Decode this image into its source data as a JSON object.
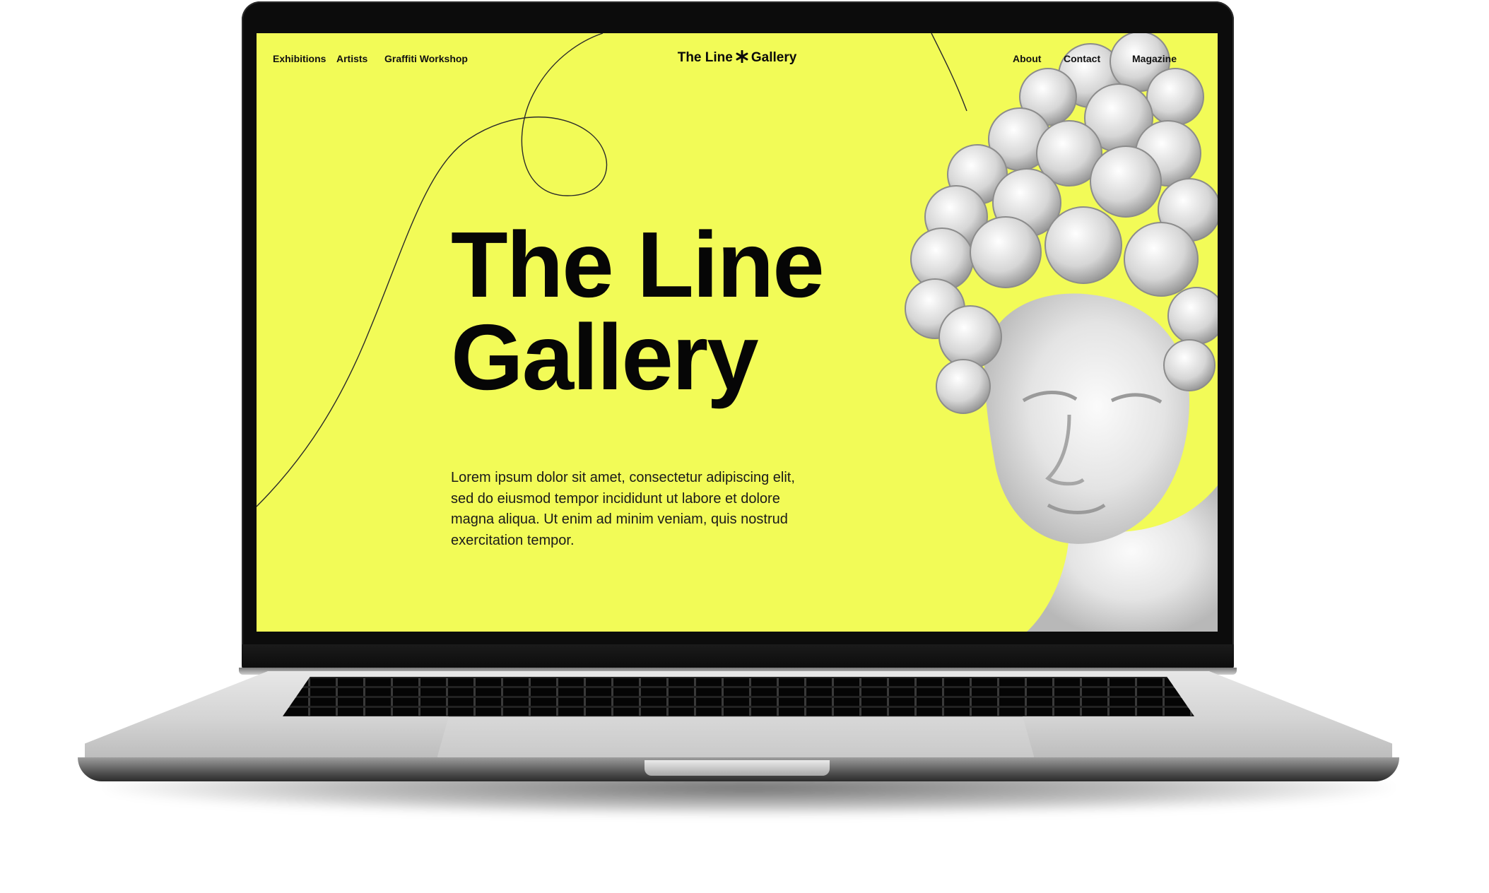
{
  "page": {
    "brand": {
      "left": "The Line",
      "right": "Gallery",
      "icon": "asterisk-icon"
    },
    "nav_left": [
      "Exhibitions",
      "Artists",
      "Graffiti Workshop"
    ],
    "nav_right": [
      "About",
      "Contact",
      "Magazine"
    ],
    "hero_title_line1": "The Line",
    "hero_title_line2": "Gallery",
    "hero_text_lines": [
      "Lorem ipsum dolor sit amet, consectetur adipiscing elit,",
      "sed do eiusmod tempor incididunt ut labore et dolore",
      "magna aliqua. Ut enim ad minim veniam, quis nostrud",
      "exercitation tempor."
    ],
    "hero_image": "classical-statue-bust"
  },
  "colors": {
    "accent_yellow": "#f2fb57",
    "text_dark": "#060606",
    "laptop_bezel": "#0c0c0c",
    "laptop_body": "#d4d4d4"
  }
}
